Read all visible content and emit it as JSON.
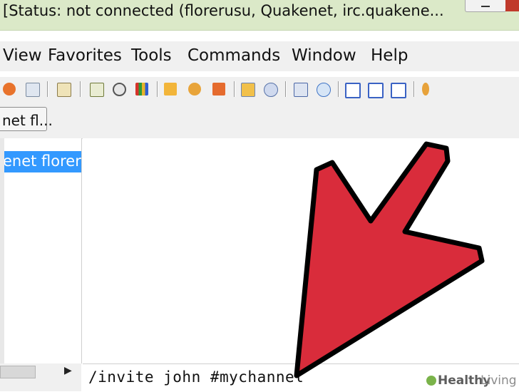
{
  "window": {
    "title": "[Status: not connected (florerusu, Quakenet, irc.quakene..."
  },
  "menu": {
    "items": [
      "View",
      "Favorites",
      "Tools",
      "Commands",
      "Window",
      "Help"
    ]
  },
  "toolbar": {
    "icons": [
      "favorites-icon",
      "notes-icon",
      "log-icon",
      "list-icon",
      "timer-icon",
      "colors-icon",
      "dcc-send-icon",
      "dcc-chat-icon",
      "dcc-options-icon",
      "channels-icon",
      "search-icon",
      "addressbook-icon",
      "url-icon",
      "tile-horizontal-icon",
      "tile-vertical-icon",
      "cascade-icon",
      "help-icon"
    ]
  },
  "switchbar": {
    "button_label": "net fl..."
  },
  "treebar": {
    "selected_item": "enet florer"
  },
  "editbox": {
    "value": "/invite john #mychannel"
  },
  "watermark": {
    "brand_bold": "Healthy",
    "brand_light": "Living"
  },
  "colors": {
    "titlebar": "#dbe9c8",
    "selection": "#3399ff",
    "arrow_fill": "#d92c3b",
    "arrow_stroke": "#000000"
  }
}
